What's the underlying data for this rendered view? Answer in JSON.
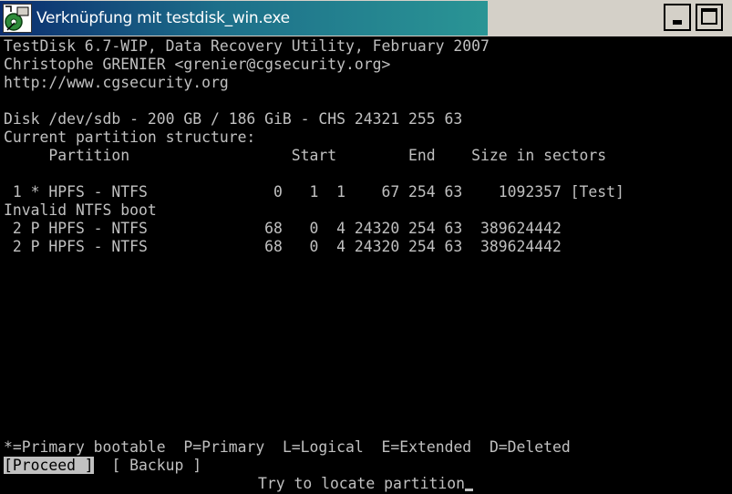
{
  "window": {
    "title": "Verknüpfung mit testdisk_win.exe",
    "icon": "testdisk-app-icon",
    "minimize_icon": "minimize-icon",
    "maximize_icon": "maximize-icon"
  },
  "header": {
    "line1": "TestDisk 6.7-WIP, Data Recovery Utility, February 2007",
    "line2": "Christophe GRENIER <grenier@cgsecurity.org>",
    "line3": "http://www.cgsecurity.org"
  },
  "disk": {
    "info": "Disk /dev/sdb - 200 GB / 186 GiB - CHS 24321 255 63",
    "structure_label": "Current partition structure:"
  },
  "table": {
    "header": "     Partition                  Start        End    Size in sectors",
    "rows": [
      {
        "text": " 1 * HPFS - NTFS              0   1  1    67 254 63    1092357 [Test]"
      },
      {
        "text": "Invalid NTFS boot"
      },
      {
        "text": " 2 P HPFS - NTFS             68   0  4 24320 254 63  389624442"
      },
      {
        "text": " 2 P HPFS - NTFS             68   0  4 24320 254 63  389624442"
      }
    ]
  },
  "legend": {
    "primary_bootable": "*=Primary bootable",
    "primary": "P=Primary",
    "logical": "L=Logical",
    "extended": "E=Extended",
    "deleted": "D=Deleted"
  },
  "menu": {
    "proceed": "[Proceed ]",
    "backup": "[ Backup ]"
  },
  "status": {
    "message": "Try to locate partition"
  },
  "colors": {
    "console_bg": "#000000",
    "console_fg": "#c0c0c0",
    "titlebar_start": "#0b2d6f",
    "titlebar_end": "#2a9595",
    "titlebar_inactive": "#d4d0c8"
  }
}
